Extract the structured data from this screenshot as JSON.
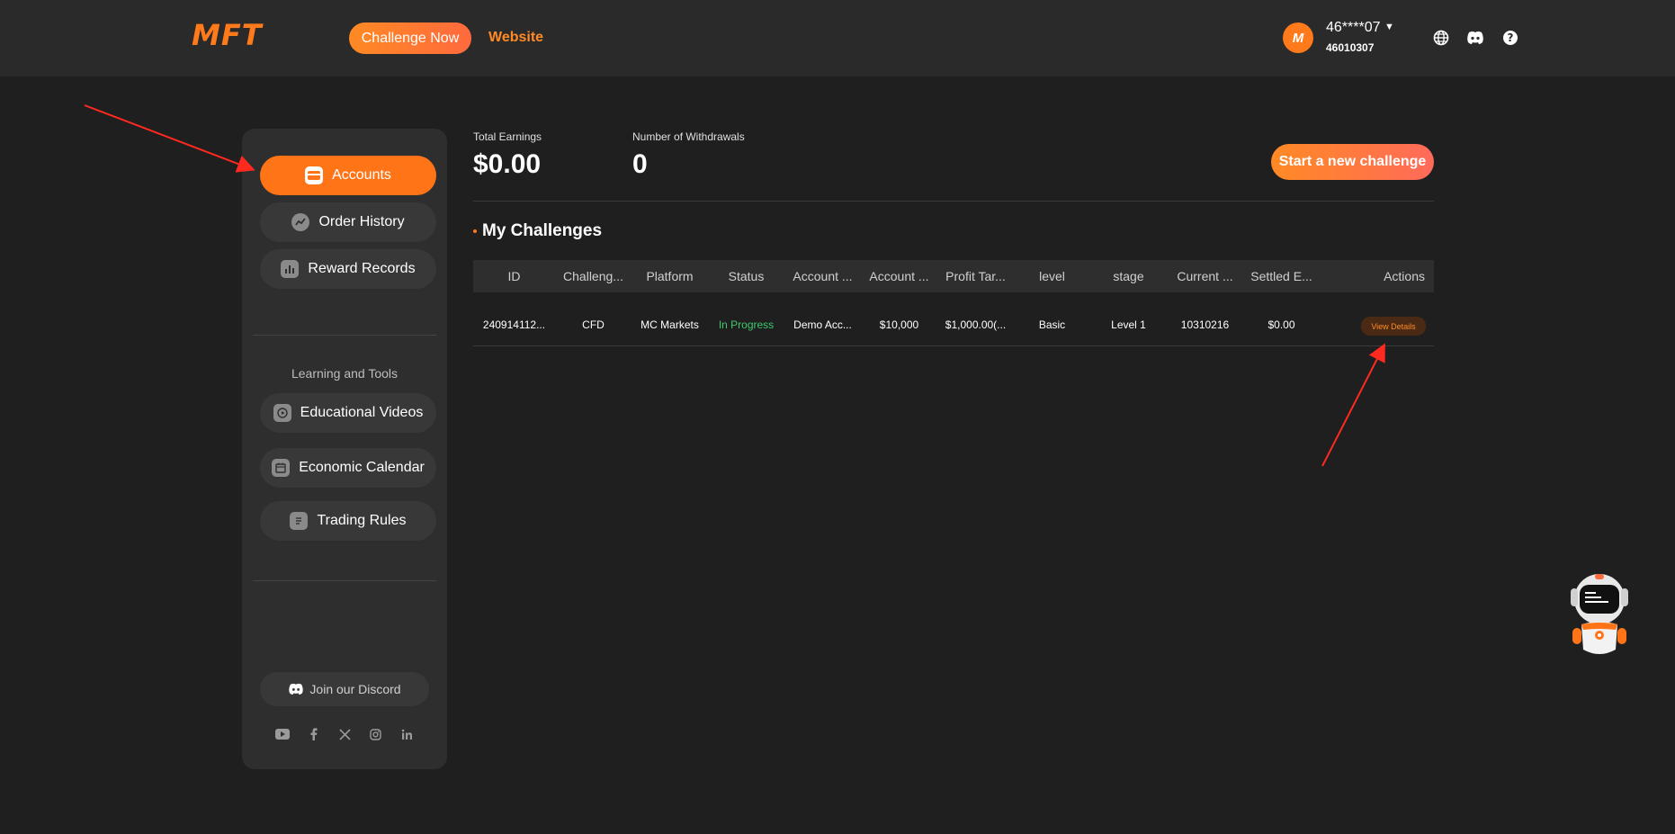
{
  "header": {
    "logo": "MFT",
    "challenge_now": "Challenge Now",
    "website": "Website",
    "avatar_letter": "M",
    "user_name": "46****07",
    "user_id": "46010307",
    "icons": [
      "globe-icon",
      "discord-icon",
      "help-icon"
    ]
  },
  "sidebar": {
    "items": [
      {
        "label": "Accounts",
        "icon": "card-icon"
      },
      {
        "label": "Order History",
        "icon": "chart-line-icon"
      },
      {
        "label": "Reward Records",
        "icon": "bar-chart-icon"
      }
    ],
    "section_label": "Learning and Tools",
    "tools": [
      {
        "label": "Educational Videos",
        "icon": "play-icon"
      },
      {
        "label": "Economic Calendar",
        "icon": "calendar-icon"
      },
      {
        "label": "Trading Rules",
        "icon": "document-icon"
      }
    ],
    "discord": "Join our Discord",
    "socials": [
      "youtube-icon",
      "facebook-icon",
      "x-icon",
      "instagram-icon",
      "linkedin-icon"
    ]
  },
  "stats": {
    "total_earnings_label": "Total Earnings",
    "total_earnings_value": "$0.00",
    "withdrawals_label": "Number of Withdrawals",
    "withdrawals_value": "0"
  },
  "start_new": "Start a new challenge",
  "section_title": "My Challenges",
  "table": {
    "headers": [
      "ID",
      "Challeng...",
      "Platform",
      "Status",
      "Account ...",
      "Account ...",
      "Profit Tar...",
      "level",
      "stage",
      "Current ...",
      "Settled E...",
      "Actions"
    ],
    "rows": [
      {
        "id": "240914112...",
        "challenge": "CFD",
        "platform": "MC Markets",
        "status": "In Progress",
        "account_type": "Demo Acc...",
        "account_size": "$10,000",
        "profit_target": "$1,000.00(...",
        "level": "Basic",
        "stage": "Level 1",
        "current": "10310216",
        "settled": "$0.00",
        "action": "View Details"
      }
    ]
  },
  "colors": {
    "accent": "#ff7417",
    "status_green": "#3ec76d",
    "background": "#1f1f1f",
    "header_bg": "#2a2a2a",
    "sidebar_bg": "#2e2e2e"
  }
}
